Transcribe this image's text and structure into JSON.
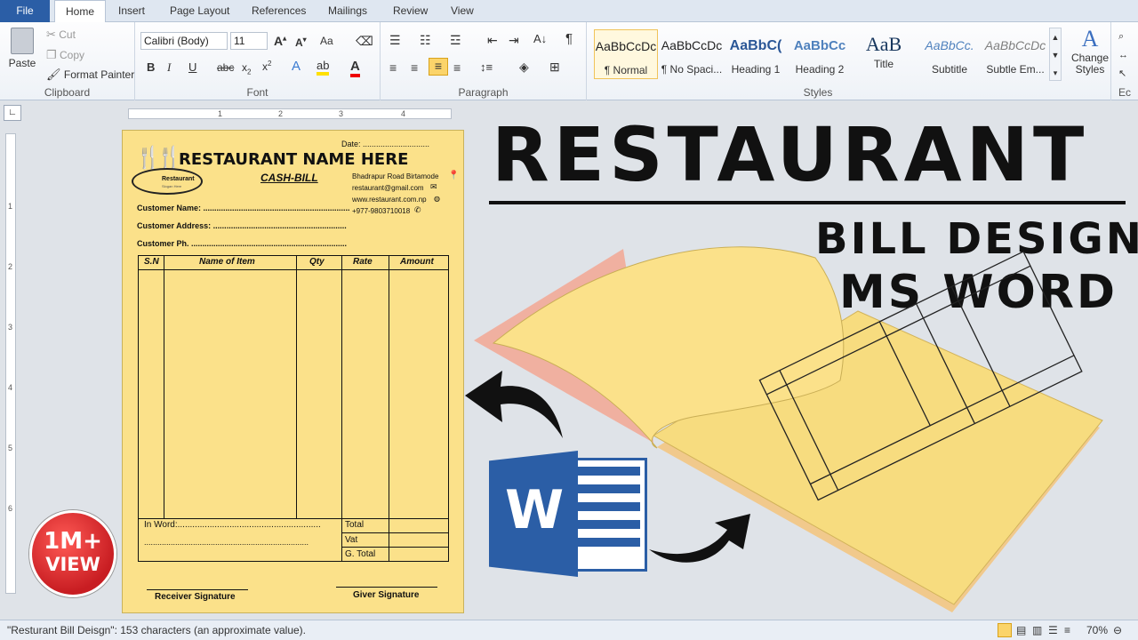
{
  "ribbon_tabs": [
    "File",
    "Home",
    "Insert",
    "Page Layout",
    "References",
    "Mailings",
    "Review",
    "View"
  ],
  "clipboard": {
    "paste": "Paste",
    "cut": "Cut",
    "copy": "Copy",
    "format_painter": "Format Painter",
    "label": "Clipboard"
  },
  "font": {
    "family": "Calibri (Body)",
    "size": "11",
    "label": "Font",
    "change_case": "Aa"
  },
  "paragraph": {
    "label": "Paragraph"
  },
  "styles": {
    "label": "Styles",
    "items": [
      {
        "preview": "AaBbCcDc",
        "name": "¶ Normal"
      },
      {
        "preview": "AaBbCcDc",
        "name": "¶ No Spaci..."
      },
      {
        "preview": "AaBbC(",
        "name": "Heading 1"
      },
      {
        "preview": "AaBbCc",
        "name": "Heading 2"
      },
      {
        "preview": "AaB",
        "name": "Title"
      },
      {
        "preview": "AaBbCc.",
        "name": "Subtitle"
      },
      {
        "preview": "AaBbCcDc",
        "name": "Subtle Em..."
      }
    ],
    "change_styles": "Change Styles",
    "editing_label": "Ec"
  },
  "bill": {
    "date": "Date: ..............................",
    "title": "RESTAURANT NAME HERE",
    "subtitle": "CASH-BILL",
    "logo_text": "Restaurant",
    "logo_tag": "Slogan Here",
    "address": "Bhadrapur Road Birtamode",
    "email": "restaurant@gmail.com",
    "website": "www.restaurant.com.np",
    "phone": "+977-9803710018",
    "customer_name": "Customer Name: ..................................................................",
    "customer_address": "Customer Address: ............................................................",
    "customer_phone": "Customer Ph. ......................................................................",
    "columns": [
      "S.N",
      "Name of Item",
      "Qty",
      "Rate",
      "Amount"
    ],
    "in_word": "In Word:..........................................................",
    "in_word_line2": "..........................................................................",
    "total": "Total",
    "vat": "Vat",
    "grand_total": "G. Total",
    "receiver_signature": "Receiver Signature",
    "giver_signature": "Giver Signature"
  },
  "thumbnail": {
    "headline1": "RESTAURANT",
    "headline2": "BILL DESIGN",
    "headline3": "MS WORD",
    "badge_top": "1M+",
    "badge_bottom": "VIEW",
    "word_logo_letter": "W"
  },
  "status": {
    "text": "\"Resturant Bill Deisgn\": 153 characters (an approximate value).",
    "zoom": "70%"
  },
  "colors": {
    "page_yellow": "#fbe18a",
    "word_blue": "#2b5ea6",
    "badge_red": "#d4262b"
  }
}
